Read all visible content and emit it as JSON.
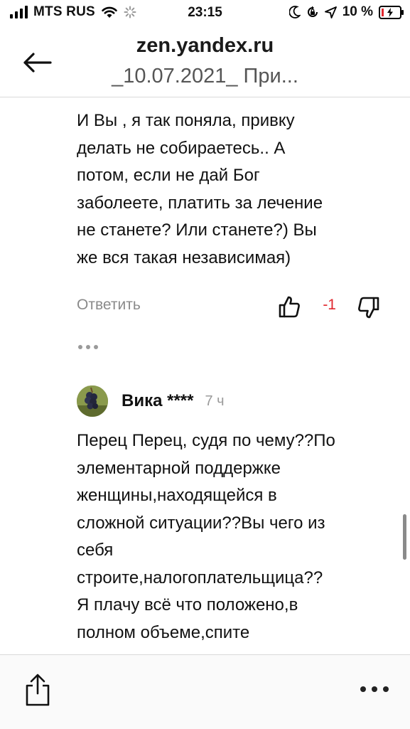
{
  "status_bar": {
    "carrier": "MTS RUS",
    "time": "23:15",
    "battery_percent": "10 %"
  },
  "nav": {
    "title": "zen.yandex.ru",
    "subtitle": "_10.07.2021_ При..."
  },
  "comments": [
    {
      "lines": [
        "И Вы , я так поняла, привку",
        "делать не собираетесь.. А",
        "потом, если не дай Бог",
        "заболеете, платить за лечение",
        "не станете? Или станете?) Вы",
        "же вся такая независимая)"
      ],
      "reply_label": "Ответить",
      "score": "-1"
    },
    {
      "author": "Вика ****",
      "time_ago": "7 ч",
      "lines": [
        "Перец Перец, судя по чему??По",
        "элементарной поддержке",
        "женщины,находящейся в",
        "сложной ситуации??Вы чего из",
        "себя",
        "строите,налогоплательщица??",
        "Я плачу всё что положено,в",
        "полном объеме,спите"
      ]
    }
  ],
  "colors": {
    "negative_score": "#e0262d",
    "muted_text": "#8a8a8a",
    "divider": "#d9d9d9"
  },
  "icons": {
    "back": "arrow-left-icon",
    "like": "thumbs-up-icon",
    "dislike": "thumbs-down-icon",
    "share": "share-icon",
    "menu": "more-horizontal-icon"
  }
}
